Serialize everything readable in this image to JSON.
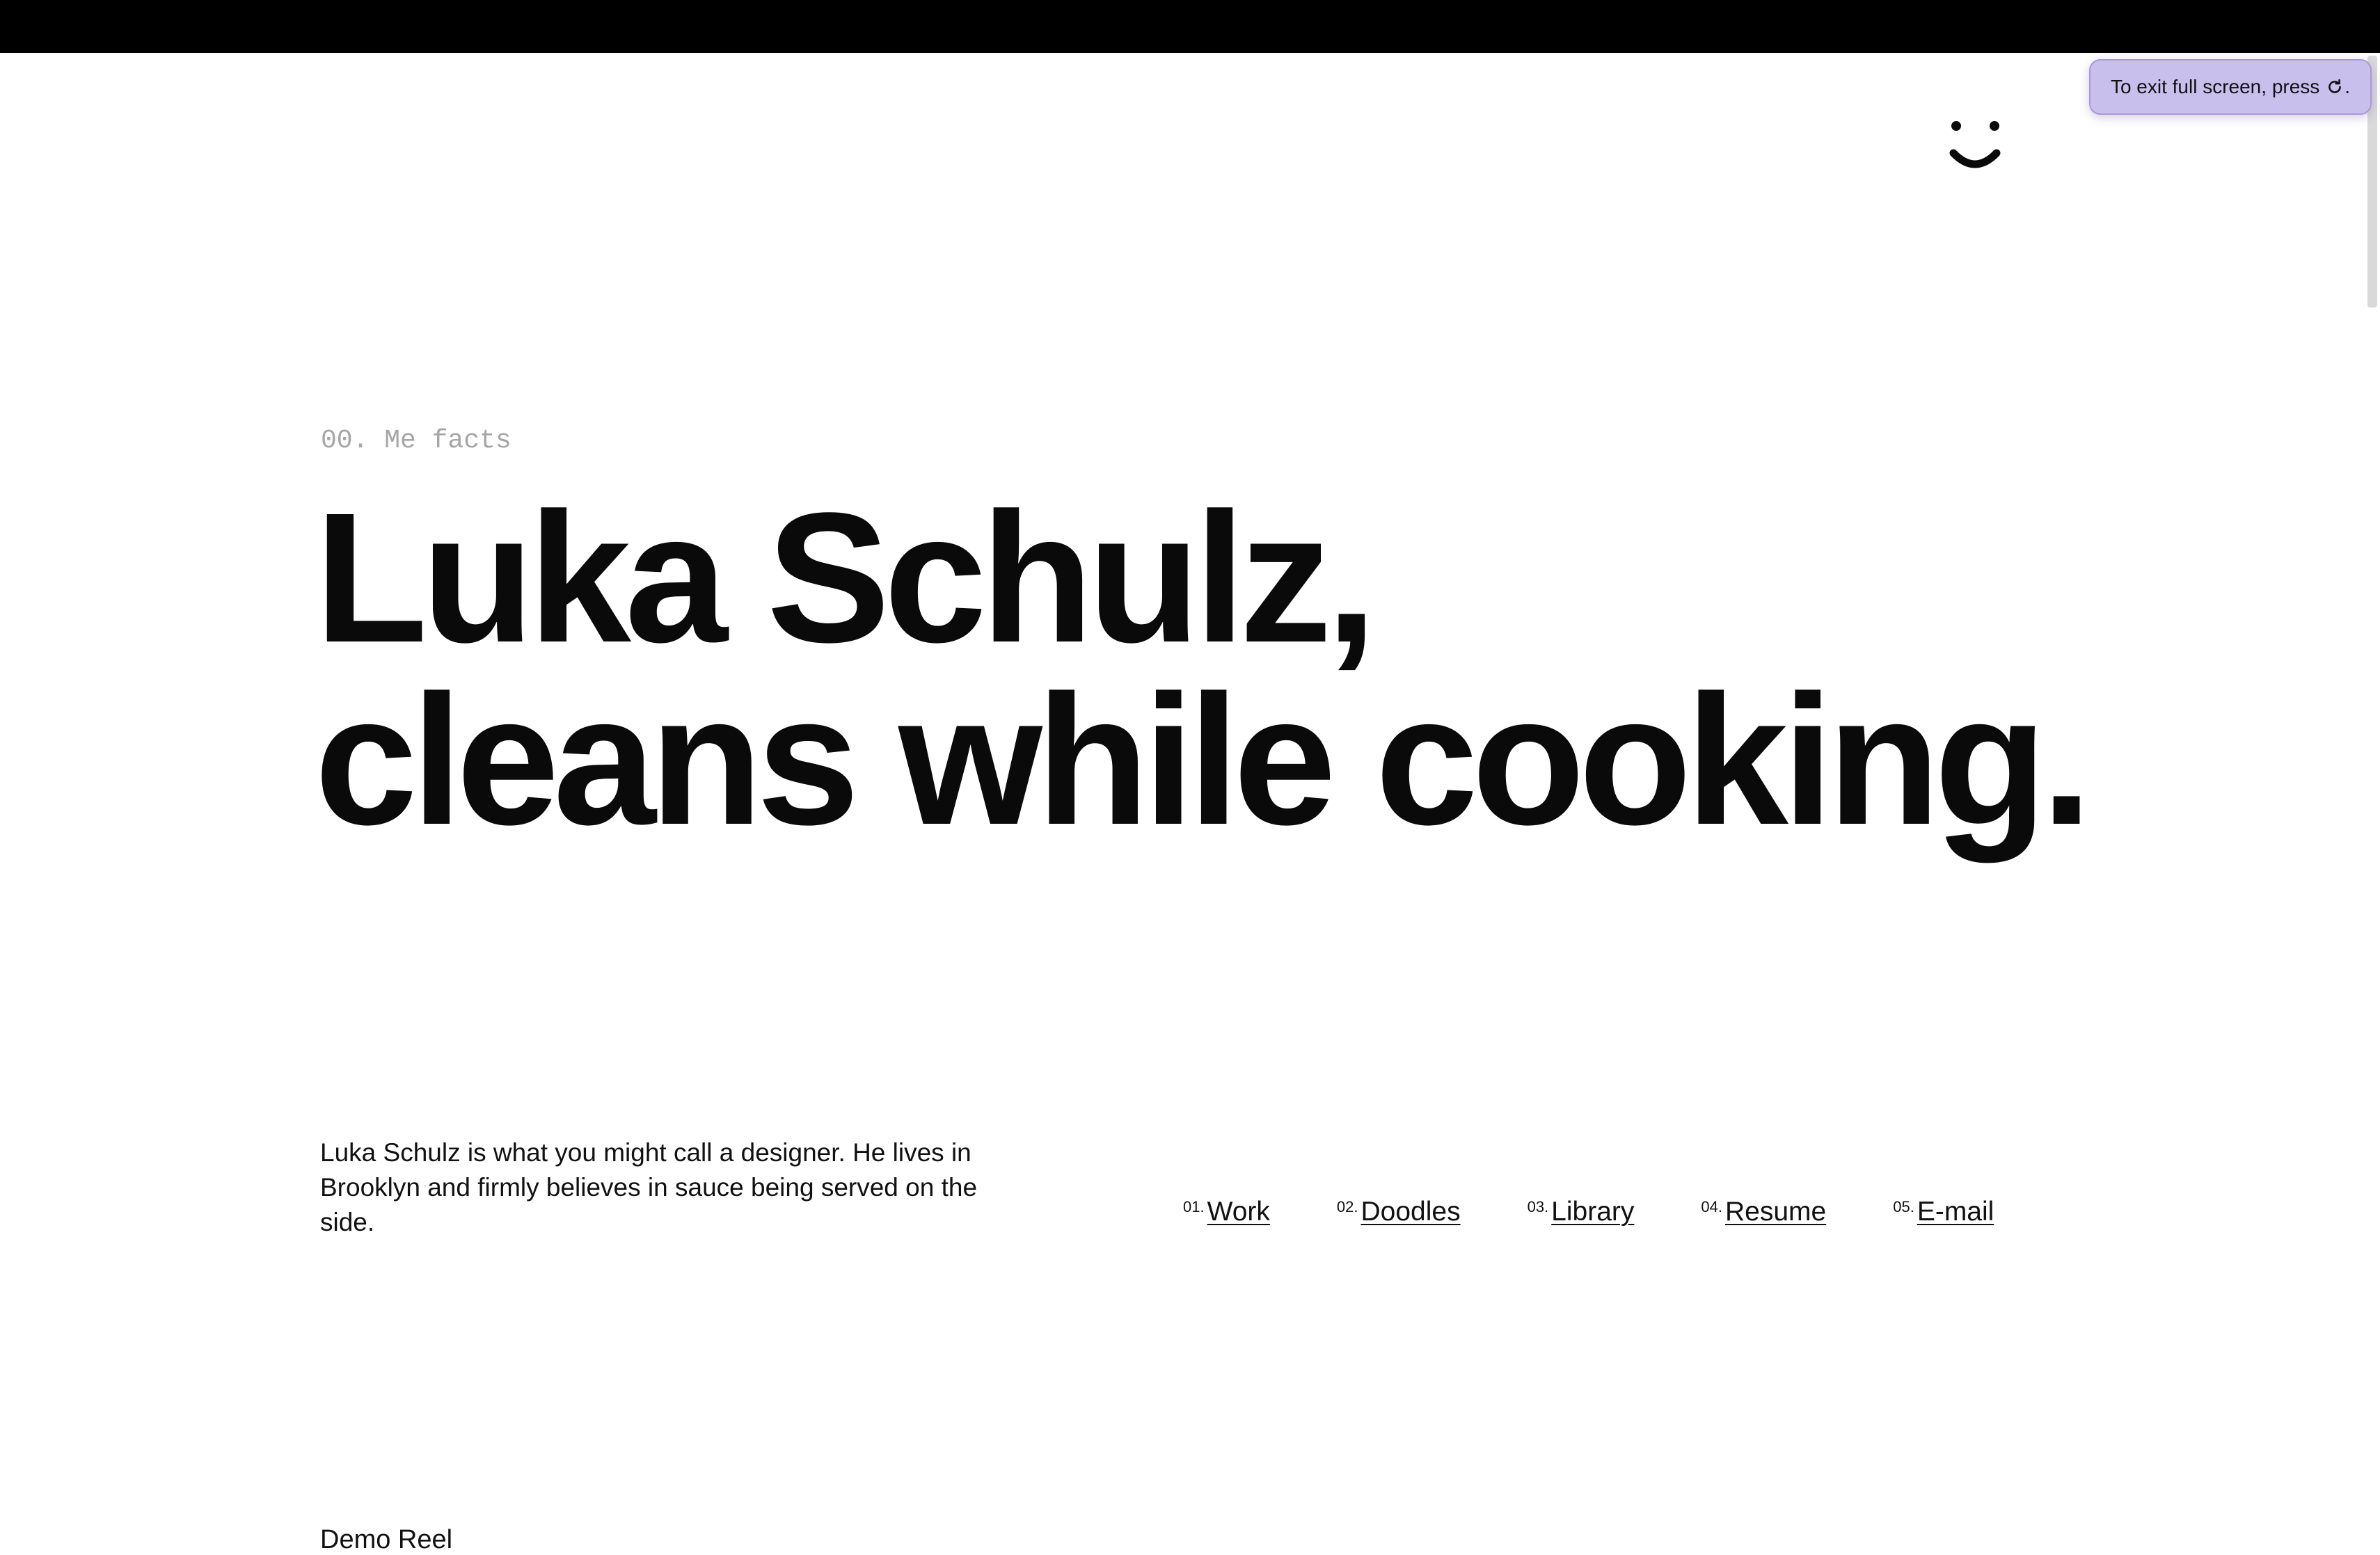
{
  "browser": {
    "fullscreen_toast": "To exit full screen, press",
    "toast_bg": "#c8bfec"
  },
  "header": {
    "logo_icon": "smiley-face-icon"
  },
  "hero": {
    "eyebrow": "00. Me facts",
    "headline_line1": "Luka Schulz,",
    "headline_line2": "cleans while cooking."
  },
  "intro": {
    "bio": "Luka Schulz is what you might call a designer. He lives in Brooklyn and firmly believes in sauce being served on the side."
  },
  "nav": {
    "items": [
      {
        "num": "01.",
        "label": "Work"
      },
      {
        "num": "02.",
        "label": "Doodles"
      },
      {
        "num": "03.",
        "label": "Library"
      },
      {
        "num": "04.",
        "label": "Resume"
      },
      {
        "num": "05.",
        "label": "E-mail"
      }
    ]
  },
  "next_section": {
    "title": "Demo Reel"
  }
}
